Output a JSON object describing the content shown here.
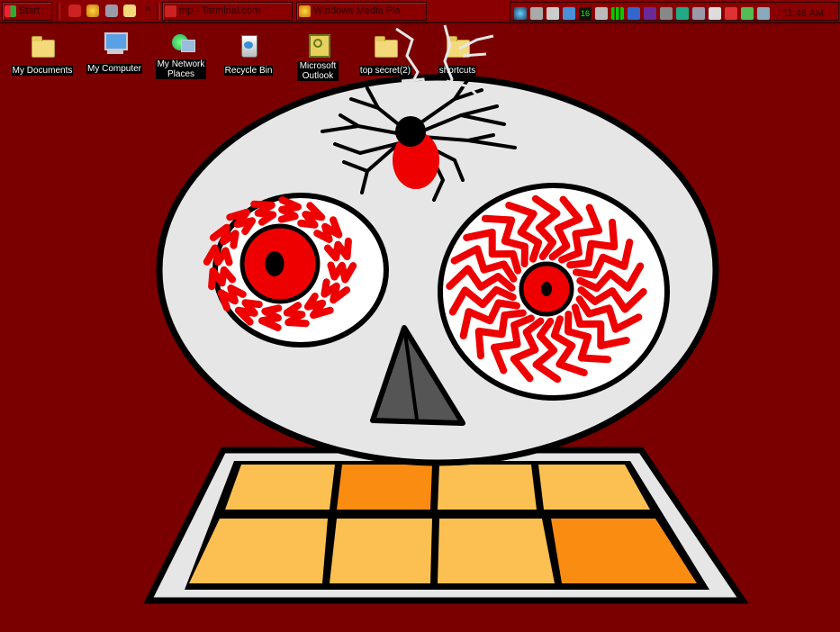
{
  "taskbar": {
    "start_label": "Start",
    "window_buttons": [
      {
        "label": "mp - Terminal.com"
      },
      {
        "label": "Windows Media Pla"
      }
    ],
    "tray_number": "16",
    "clock": "11:46 AM",
    "chevron": "»"
  },
  "desktop": {
    "icons": [
      {
        "label": "My Documents"
      },
      {
        "label": "My Computer"
      },
      {
        "label": "My Network Places"
      },
      {
        "label": "Recycle Bin"
      },
      {
        "label": "Microsoft Outlook"
      },
      {
        "label": "top secret(2)"
      },
      {
        "label": "shortcuts"
      }
    ]
  },
  "colors": {
    "desktop_bg": "#7a0000",
    "skull": "#e6e6e6",
    "eye_red": "#ee0000",
    "tile_light": "#fcc052",
    "tile_dark": "#fb8c12"
  }
}
